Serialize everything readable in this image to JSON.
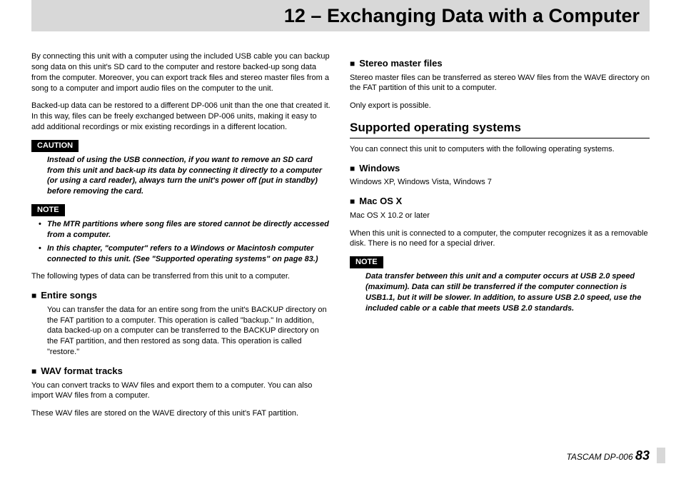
{
  "header": {
    "title": "12 – Exchanging Data with a Computer"
  },
  "left": {
    "intro1": "By connecting this unit with a computer using the included USB cable you can backup song data on this unit's SD card to the computer and restore backed-up song data from the computer. Moreover, you can export track files and stereo master files from a song to a computer and import audio files on the computer to the unit.",
    "intro2": "Backed-up data can be restored to a different DP-006 unit than the one that created it. In this way, files can be freely exchanged between DP-006 units, making it easy to add additional recordings or mix existing recordings in a different location.",
    "caution_label": "CAUTION",
    "caution_body": "Instead of using the USB connection, if you want to remove an SD card from this unit and back-up its data by connecting it directly to a computer (or using a card reader), always turn the unit's power off (put in standby) before removing the card.",
    "note_label": "NOTE",
    "note_items": [
      "The MTR partitions where song files are stored cannot be directly accessed from a computer.",
      "In this chapter, \"computer\" refers to a Windows or Macintosh computer connected to this unit. (See \"Supported operating systems\" on page 83.)"
    ],
    "transfer_intro": "The following types of data can be transferred from this unit to a computer.",
    "entire_head": "Entire songs",
    "entire_body": "You can transfer the data for an entire song from the unit's BACKUP directory on the FAT partition to a computer. This operation is called \"backup.\" In addition, data backed-up on a computer can be transferred to the BACKUP directory on the FAT partition, and then restored as song data. This operation is called \"restore.\"",
    "wav_head": "WAV format tracks",
    "wav_body1": "You can convert tracks to WAV files and export them to a computer. You can also import WAV files from a computer.",
    "wav_body2": "These WAV files are stored on the WAVE directory of this unit's FAT partition."
  },
  "right": {
    "stereo_head": "Stereo master files",
    "stereo_body1": "Stereo master files can be transferred as stereo WAV files from the WAVE directory on the FAT partition of this unit to a computer.",
    "stereo_body2": "Only export is possible.",
    "os_head": "Supported operating systems",
    "os_intro": "You can connect this unit to computers with the following operating systems.",
    "win_head": "Windows",
    "win_body": "Windows XP, Windows Vista, Windows 7",
    "mac_head": "Mac OS X",
    "mac_body1": "Mac OS X 10.2 or later",
    "mac_body2": "When this unit is connected to a computer, the computer recognizes it as a removable disk. There is no need for a special driver.",
    "note_label": "NOTE",
    "note_body": "Data transfer between this unit and a computer occurs at USB 2.0 speed (maximum). Data can still be transferred if the computer connection is USB1.1, but it will be slower. In addition, to assure USB 2.0 speed, use the included cable or a cable that meets USB 2.0 standards."
  },
  "footer": {
    "product": "TASCAM  DP-006",
    "page": "83"
  }
}
